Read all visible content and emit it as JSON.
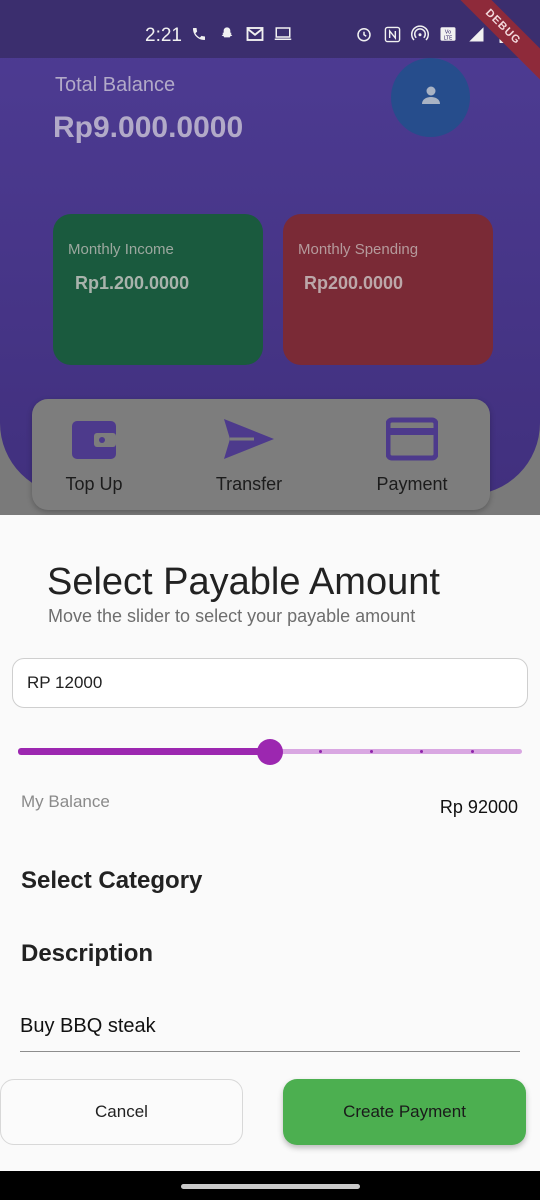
{
  "status_bar": {
    "time": "2:21",
    "left_icons": [
      "phone-icon",
      "snapchat-icon",
      "gmail-icon",
      "screen-cast-icon"
    ],
    "right_icons": [
      "alarm-icon",
      "nfc-icon",
      "hotspot-icon",
      "volte-icon",
      "4g-signal-icon",
      "battery-icon"
    ],
    "debug_label": "DEBUG"
  },
  "home": {
    "balance_label": "Total Balance",
    "balance_value": "Rp9.000.0000",
    "avatar_icon": "person-icon",
    "income_label": "Monthly Income",
    "income_value": "Rp1.200.0000",
    "spending_label": "Monthly Spending",
    "spending_value": "Rp200.0000",
    "actions": [
      {
        "label": "Top Up",
        "icon": "wallet-icon"
      },
      {
        "label": "Transfer",
        "icon": "send-icon"
      },
      {
        "label": "Payment",
        "icon": "credit-card-icon"
      }
    ]
  },
  "sheet": {
    "title": "Select Payable Amount",
    "subtitle": "Move the slider to select your payable amount",
    "amount_value": "RP 12000",
    "slider": {
      "value_fraction": 0.5,
      "divisions": 5,
      "active_color": "#9c27b0",
      "inactive_color": "#d9a7e2"
    },
    "my_balance_label": "My Balance",
    "my_balance_value": "Rp 92000",
    "category_heading": "Select Category",
    "description_heading": "Description",
    "description_value": "Buy BBQ steak",
    "cancel_label": "Cancel",
    "create_label": "Create Payment",
    "create_color": "#4caf50"
  }
}
